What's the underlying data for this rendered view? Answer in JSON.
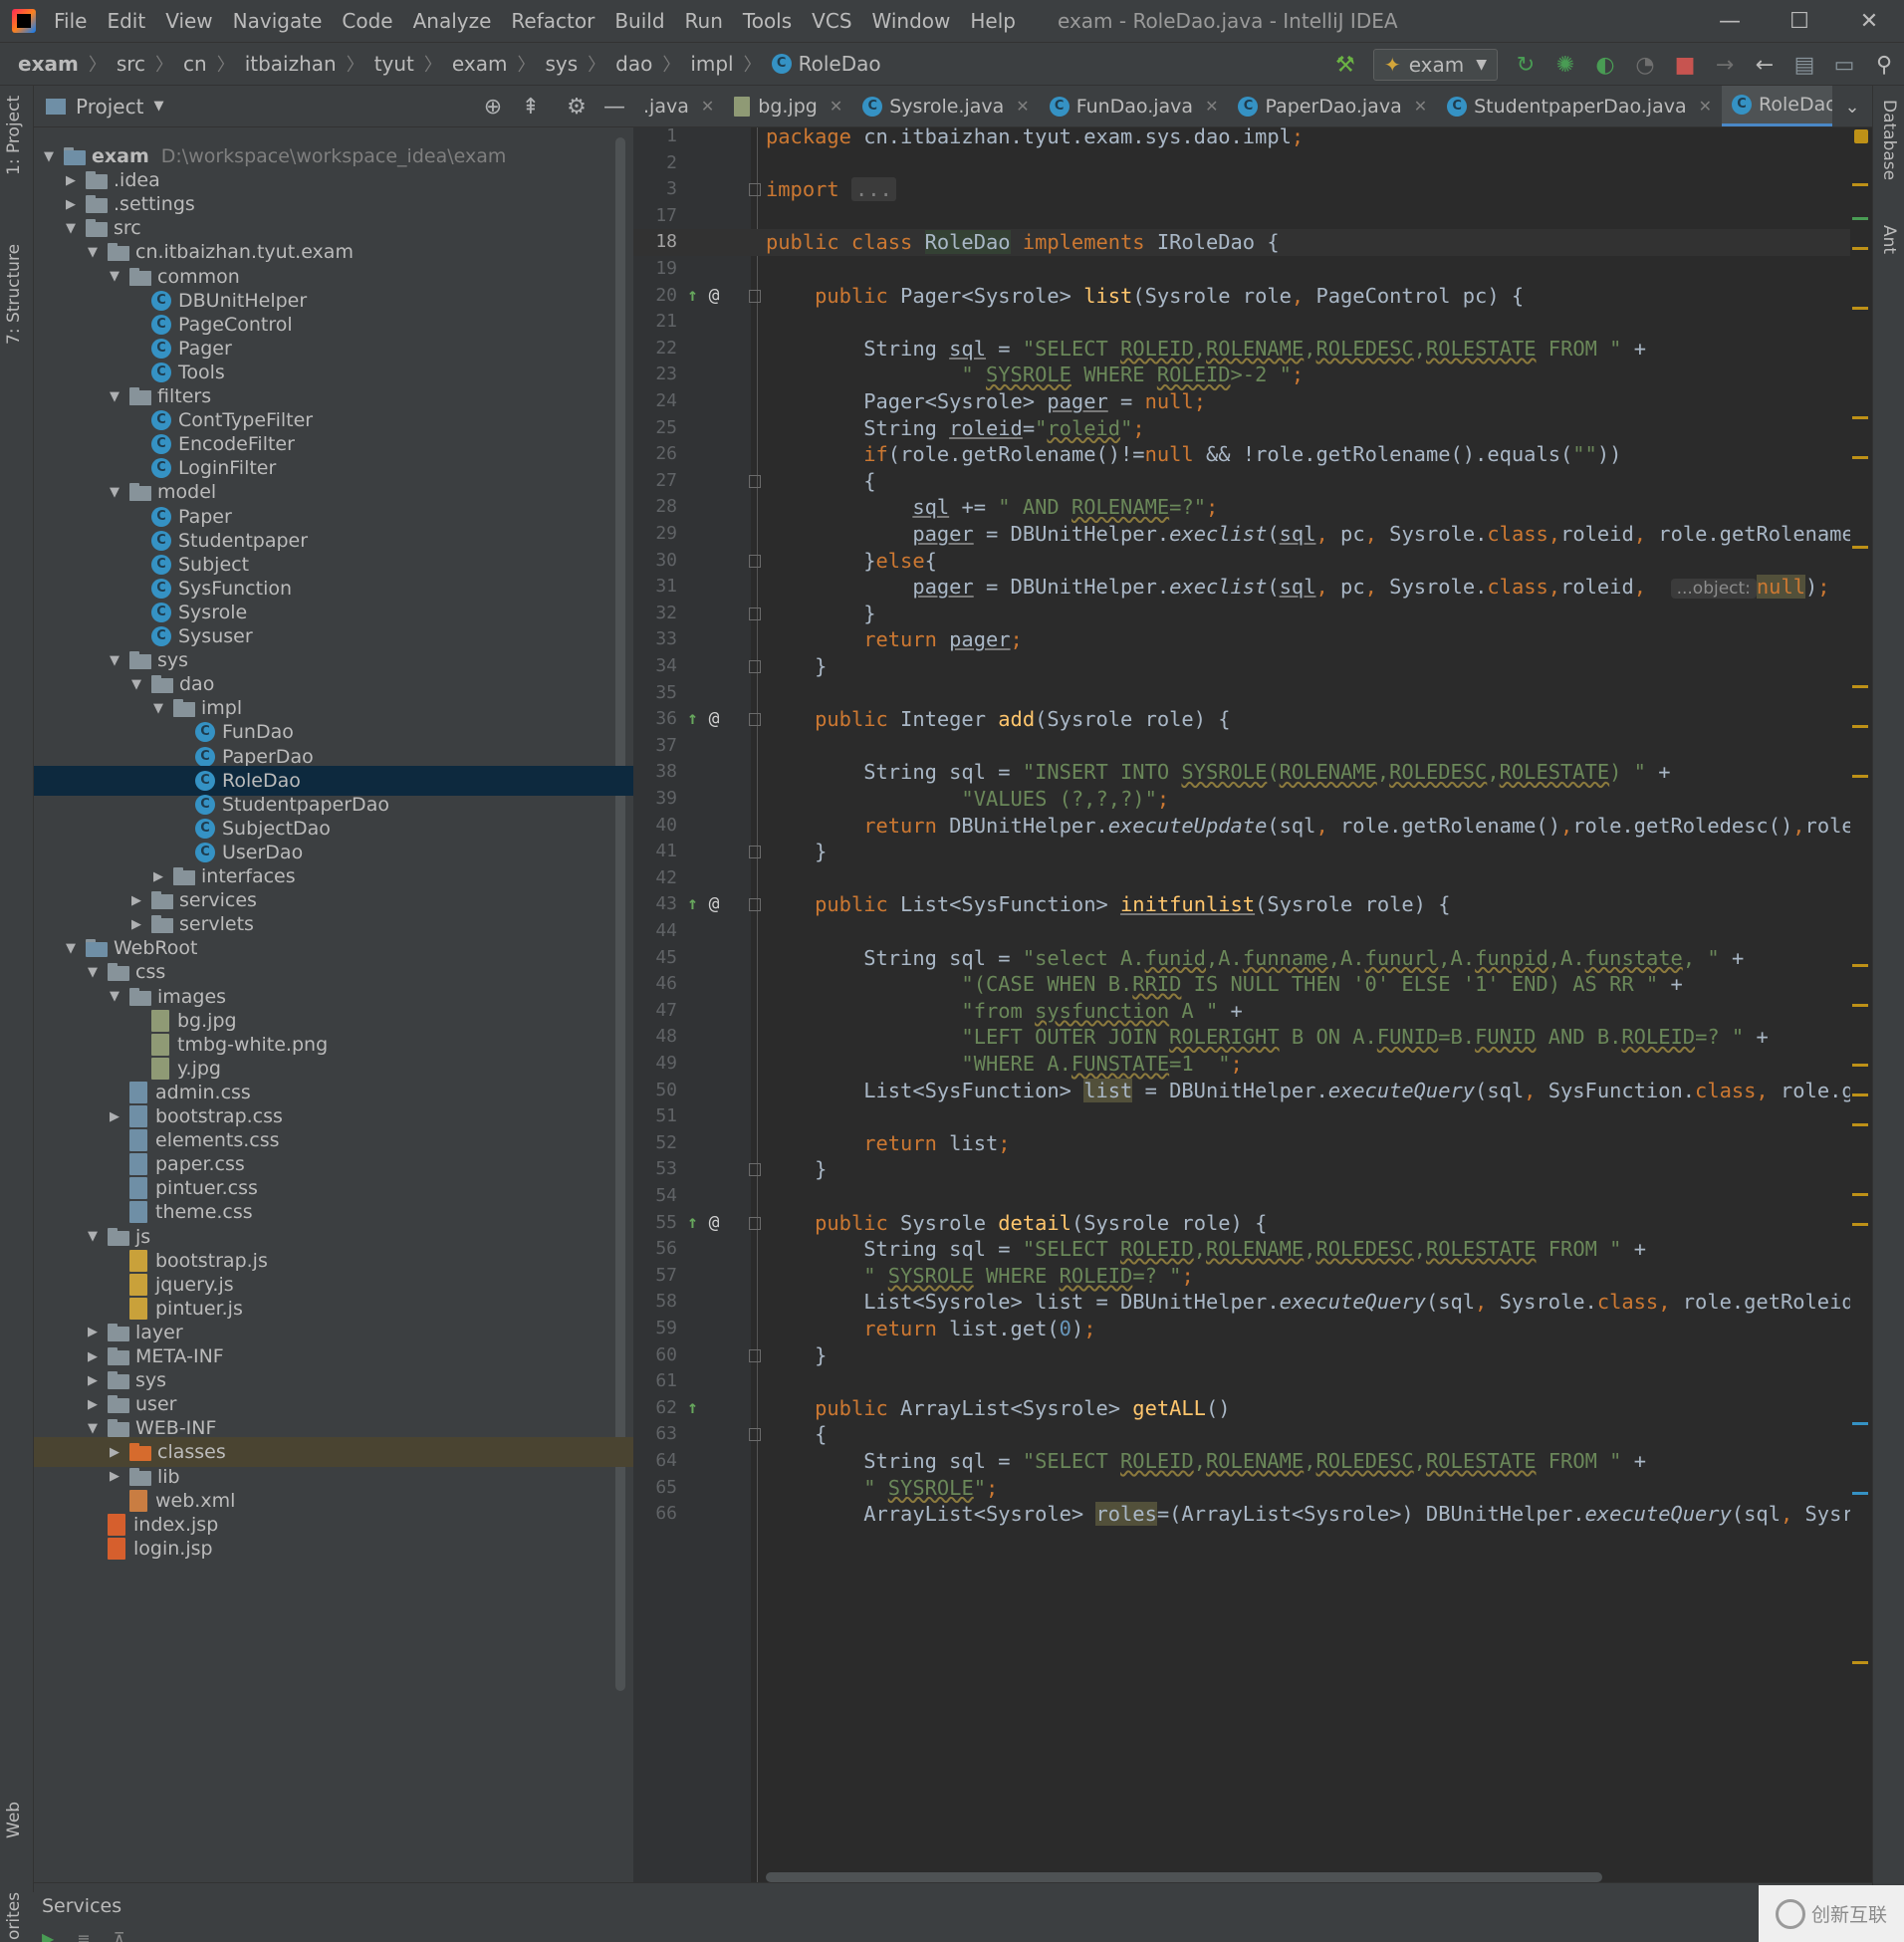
{
  "window": {
    "title": "exam - RoleDao.java - IntelliJ IDEA",
    "menu": [
      "File",
      "Edit",
      "View",
      "Navigate",
      "Code",
      "Analyze",
      "Refactor",
      "Build",
      "Run",
      "Tools",
      "VCS",
      "Window",
      "Help"
    ]
  },
  "breadcrumb": [
    "exam",
    "src",
    "cn",
    "itbaizhan",
    "tyut",
    "exam",
    "sys",
    "dao",
    "impl",
    "RoleDao"
  ],
  "toolbar": {
    "run_config": "exam"
  },
  "side_tabs": {
    "project": "1: Project",
    "structure": "7: Structure",
    "web": "Web",
    "favorites": "orites",
    "database": "Database",
    "ant": "Ant"
  },
  "project_panel": {
    "title": "Project",
    "tree": [
      {
        "depth": 0,
        "type": "module",
        "label": "exam",
        "path": "D:\\workspace\\workspace_idea\\exam",
        "arrow": "down"
      },
      {
        "depth": 1,
        "type": "folder",
        "label": ".idea",
        "arrow": "right"
      },
      {
        "depth": 1,
        "type": "folder",
        "label": ".settings",
        "arrow": "right"
      },
      {
        "depth": 1,
        "type": "folder",
        "label": "src",
        "arrow": "down"
      },
      {
        "depth": 2,
        "type": "package",
        "label": "cn.itbaizhan.tyut.exam",
        "arrow": "down"
      },
      {
        "depth": 3,
        "type": "package",
        "label": "common",
        "arrow": "down"
      },
      {
        "depth": 4,
        "type": "class",
        "label": "DBUnitHelper"
      },
      {
        "depth": 4,
        "type": "class",
        "label": "PageControl"
      },
      {
        "depth": 4,
        "type": "class",
        "label": "Pager"
      },
      {
        "depth": 4,
        "type": "class",
        "label": "Tools"
      },
      {
        "depth": 3,
        "type": "package",
        "label": "filters",
        "arrow": "down"
      },
      {
        "depth": 4,
        "type": "class",
        "label": "ContTypeFilter"
      },
      {
        "depth": 4,
        "type": "class",
        "label": "EncodeFilter"
      },
      {
        "depth": 4,
        "type": "class",
        "label": "LoginFilter"
      },
      {
        "depth": 3,
        "type": "package",
        "label": "model",
        "arrow": "down"
      },
      {
        "depth": 4,
        "type": "class",
        "label": "Paper"
      },
      {
        "depth": 4,
        "type": "class",
        "label": "Studentpaper"
      },
      {
        "depth": 4,
        "type": "class",
        "label": "Subject"
      },
      {
        "depth": 4,
        "type": "class",
        "label": "SysFunction"
      },
      {
        "depth": 4,
        "type": "class",
        "label": "Sysrole"
      },
      {
        "depth": 4,
        "type": "class",
        "label": "Sysuser"
      },
      {
        "depth": 3,
        "type": "package",
        "label": "sys",
        "arrow": "down"
      },
      {
        "depth": 4,
        "type": "package",
        "label": "dao",
        "arrow": "down"
      },
      {
        "depth": 5,
        "type": "package",
        "label": "impl",
        "arrow": "down"
      },
      {
        "depth": 6,
        "type": "class",
        "label": "FunDao"
      },
      {
        "depth": 6,
        "type": "class",
        "label": "PaperDao"
      },
      {
        "depth": 6,
        "type": "class",
        "label": "RoleDao",
        "selected": true
      },
      {
        "depth": 6,
        "type": "class",
        "label": "StudentpaperDao"
      },
      {
        "depth": 6,
        "type": "class",
        "label": "SubjectDao"
      },
      {
        "depth": 6,
        "type": "class",
        "label": "UserDao"
      },
      {
        "depth": 5,
        "type": "package",
        "label": "interfaces",
        "arrow": "right"
      },
      {
        "depth": 4,
        "type": "package",
        "label": "services",
        "arrow": "right"
      },
      {
        "depth": 4,
        "type": "package",
        "label": "servlets",
        "arrow": "right"
      },
      {
        "depth": 1,
        "type": "module",
        "label": "WebRoot",
        "arrow": "down"
      },
      {
        "depth": 2,
        "type": "folder",
        "label": "css",
        "arrow": "down"
      },
      {
        "depth": 3,
        "type": "folder",
        "label": "images",
        "arrow": "down"
      },
      {
        "depth": 4,
        "type": "img",
        "label": "bg.jpg"
      },
      {
        "depth": 4,
        "type": "img",
        "label": "tmbg-white.png"
      },
      {
        "depth": 4,
        "type": "img",
        "label": "y.jpg"
      },
      {
        "depth": 3,
        "type": "css",
        "label": "admin.css"
      },
      {
        "depth": 3,
        "type": "css",
        "label": "bootstrap.css",
        "arrow": "right"
      },
      {
        "depth": 3,
        "type": "css",
        "label": "elements.css"
      },
      {
        "depth": 3,
        "type": "css",
        "label": "paper.css"
      },
      {
        "depth": 3,
        "type": "css",
        "label": "pintuer.css"
      },
      {
        "depth": 3,
        "type": "css",
        "label": "theme.css"
      },
      {
        "depth": 2,
        "type": "folder",
        "label": "js",
        "arrow": "down"
      },
      {
        "depth": 3,
        "type": "js",
        "label": "bootstrap.js"
      },
      {
        "depth": 3,
        "type": "js",
        "label": "jquery.js"
      },
      {
        "depth": 3,
        "type": "js",
        "label": "pintuer.js"
      },
      {
        "depth": 2,
        "type": "folder",
        "label": "layer",
        "arrow": "right"
      },
      {
        "depth": 2,
        "type": "folder",
        "label": "META-INF",
        "arrow": "right"
      },
      {
        "depth": 2,
        "type": "folder",
        "label": "sys",
        "arrow": "right"
      },
      {
        "depth": 2,
        "type": "folder",
        "label": "user",
        "arrow": "right"
      },
      {
        "depth": 2,
        "type": "folder",
        "label": "WEB-INF",
        "arrow": "down"
      },
      {
        "depth": 3,
        "type": "orange",
        "label": "classes",
        "arrow": "right",
        "highlight": true
      },
      {
        "depth": 3,
        "type": "folder",
        "label": "lib",
        "arrow": "right"
      },
      {
        "depth": 3,
        "type": "xml",
        "label": "web.xml"
      },
      {
        "depth": 2,
        "type": "jsp",
        "label": "index.jsp"
      },
      {
        "depth": 2,
        "type": "jsp",
        "label": "login.jsp"
      }
    ]
  },
  "editor_tabs": [
    {
      "label": ".java",
      "icon": "none"
    },
    {
      "label": "bg.jpg",
      "icon": "image"
    },
    {
      "label": "Sysrole.java",
      "icon": "class"
    },
    {
      "label": "FunDao.java",
      "icon": "class"
    },
    {
      "label": "PaperDao.java",
      "icon": "class"
    },
    {
      "label": "StudentpaperDao.java",
      "icon": "class"
    },
    {
      "label": "RoleDao.java",
      "icon": "class",
      "active": true
    }
  ],
  "editor": {
    "current_line": "18",
    "lines": [
      {
        "n": "1",
        "html": "<span class=\"kw\">package </span>cn.itbaizhan.tyut.exam.sys.dao.impl<span class=\"kw\">;</span>"
      },
      {
        "n": "2",
        "html": ""
      },
      {
        "n": "3",
        "html": "<span class=\"kw\">import </span><span class=\"fold-box\">...</span>",
        "fold": true
      },
      {
        "n": "17",
        "html": ""
      },
      {
        "n": "18",
        "html": "<span class=\"kw\">public class </span><span class=\"ref\">RoleDao</span> <span class=\"kw\">implements </span>IRoleDao {"
      },
      {
        "n": "19",
        "html": ""
      },
      {
        "n": "20",
        "html": "    <span class=\"kw\">public </span>Pager&lt;Sysrole&gt; <span class=\"fn\">list</span>(Sysrole role<span class=\"kw\">, </span>PageControl pc) {",
        "impl": true,
        "fold": true
      },
      {
        "n": "21",
        "html": ""
      },
      {
        "n": "22",
        "html": "        String <span class=\"ul\">sql</span> = <span class=\"str\">\"SELECT <span class=\"sq\">ROLEID</span>,<span class=\"sq\">ROLENAME</span>,<span class=\"sq\">ROLEDESC</span>,<span class=\"sq\">ROLESTATE</span> FROM \"</span> +"
      },
      {
        "n": "23",
        "html": "                <span class=\"str\">\" <span class=\"sq\">SYSROLE</span> WHERE <span class=\"sq\">ROLEID</span>&gt;-2 \"</span><span class=\"kw\">;</span>"
      },
      {
        "n": "24",
        "html": "        Pager&lt;Sysrole&gt; <span class=\"ul\">pager</span> = <span class=\"kw\">null;</span>"
      },
      {
        "n": "25",
        "html": "        String <span class=\"ul\">roleid</span>=<span class=\"str\">\"<span class=\"sq\">roleid</span>\"</span><span class=\"kw\">;</span>"
      },
      {
        "n": "26",
        "html": "        <span class=\"kw\">if</span>(role.getRolename()!=<span class=\"kw\">null </span>&amp;&amp; !role.getRolename().equals(<span class=\"str\">\"\"</span>))"
      },
      {
        "n": "27",
        "html": "        {",
        "fold": true
      },
      {
        "n": "28",
        "html": "            <span class=\"ul\">sql</span> += <span class=\"str\">\" AND <span class=\"sq\">ROLENAME</span>=?\"</span><span class=\"kw\">;</span>"
      },
      {
        "n": "29",
        "html": "            <span class=\"ul\">pager</span> = DBUnitHelper.<span class=\"it\">execlist</span>(<span class=\"ul\">sql</span><span class=\"kw\">, </span>pc<span class=\"kw\">, </span>Sysrole.<span class=\"kw\">class,</span>roleid<span class=\"kw\">, </span>role.getRolename())<span class=\"kw\">;</span>"
      },
      {
        "n": "30",
        "html": "        }<span class=\"kw\">else</span>{",
        "fold": true
      },
      {
        "n": "31",
        "html": "            <span class=\"ul\">pager</span> = DBUnitHelper.<span class=\"it\">execlist</span>(<span class=\"ul\">sql</span><span class=\"kw\">, </span>pc<span class=\"kw\">, </span>Sysrole.<span class=\"kw\">class,</span>roleid<span class=\"kw\">, </span> <span class=\"hint\">...object:</span><span class=\"hl kw\">null</span>)<span class=\"kw\">;</span>"
      },
      {
        "n": "32",
        "html": "        }",
        "fold": true
      },
      {
        "n": "33",
        "html": "        <span class=\"kw\">return </span><span class=\"ul\">pager</span><span class=\"kw\">;</span>"
      },
      {
        "n": "34",
        "html": "    }",
        "fold": true
      },
      {
        "n": "35",
        "html": ""
      },
      {
        "n": "36",
        "html": "    <span class=\"kw\">public </span>Integer <span class=\"fn\">add</span>(Sysrole role) {",
        "impl": true,
        "fold": true
      },
      {
        "n": "37",
        "html": ""
      },
      {
        "n": "38",
        "html": "        String sql = <span class=\"str\">\"INSERT INTO <span class=\"sq\">SYSROLE</span>(<span class=\"sq\">ROLENAME</span>,<span class=\"sq\">ROLEDESC</span>,<span class=\"sq\">ROLESTATE</span>) \"</span> +"
      },
      {
        "n": "39",
        "html": "                <span class=\"str\">\"VALUES (?,?,?)\"</span><span class=\"kw\">;</span>"
      },
      {
        "n": "40",
        "html": "        <span class=\"kw\">return </span>DBUnitHelper.<span class=\"it\">executeUpdate</span>(sql<span class=\"kw\">, </span>role.getRolename()<span class=\"kw\">,</span>role.getRoledesc()<span class=\"kw\">,</span>role.getRolestate())<span class=\"kw\">;</span>"
      },
      {
        "n": "41",
        "html": "    }",
        "fold": true
      },
      {
        "n": "42",
        "html": ""
      },
      {
        "n": "43",
        "html": "    <span class=\"kw\">public </span>List&lt;SysFunction&gt; <span class=\"fn ul\">initfunlist</span>(Sysrole role) {",
        "impl": true,
        "fold": true
      },
      {
        "n": "44",
        "html": ""
      },
      {
        "n": "45",
        "html": "        String sql = <span class=\"str\">\"select A.<span class=\"sq\">funid</span>,A.<span class=\"sq\">funname</span>,A.<span class=\"sq\">funurl</span>,A.<span class=\"sq\">funpid</span>,A.<span class=\"sq\">funstate</span>, \"</span> +"
      },
      {
        "n": "46",
        "html": "                <span class=\"str\">\"(CASE WHEN B.<span class=\"sq\">RRID</span> IS NULL THEN '0' ELSE '1' END) AS RR \"</span> +"
      },
      {
        "n": "47",
        "html": "                <span class=\"str\">\"from <span class=\"sq\">sysfunction</span> A \"</span> +"
      },
      {
        "n": "48",
        "html": "                <span class=\"str\">\"LEFT OUTER JOIN <span class=\"sq\">ROLERIGHT</span> B ON A.<span class=\"sq\">FUNID</span>=B.<span class=\"sq\">FUNID</span> AND B.<span class=\"sq\">ROLEID</span>=? \"</span> +"
      },
      {
        "n": "49",
        "html": "                <span class=\"str\">\"WHERE A.<span class=\"sq\">FUNSTATE</span>=1  \"</span><span class=\"kw\">;</span>"
      },
      {
        "n": "50",
        "html": "        List&lt;SysFunction&gt; <span class=\"hl\">list</span> = DBUnitHelper.<span class=\"it\">executeQuery</span>(sql<span class=\"kw\">, </span>SysFunction.<span class=\"kw\">class, </span>role.getRoleid())<span class=\"kw\">;</span>"
      },
      {
        "n": "51",
        "html": ""
      },
      {
        "n": "52",
        "html": "        <span class=\"kw\">return </span>list<span class=\"kw\">;</span>"
      },
      {
        "n": "53",
        "html": "    }",
        "fold": true
      },
      {
        "n": "54",
        "html": ""
      },
      {
        "n": "55",
        "html": "    <span class=\"kw\">public </span>Sysrole <span class=\"fn\">detail</span>(Sysrole role) {",
        "impl": true,
        "fold": true
      },
      {
        "n": "56",
        "html": "        String sql = <span class=\"str\">\"SELECT <span class=\"sq\">ROLEID</span>,<span class=\"sq\">ROLENAME</span>,<span class=\"sq\">ROLEDESC</span>,<span class=\"sq\">ROLESTATE</span> FROM \"</span> +"
      },
      {
        "n": "57",
        "html": "        <span class=\"str\">\" <span class=\"sq\">SYSROLE</span> WHERE <span class=\"sq\">ROLEID</span>=? \"</span><span class=\"kw\">;</span>"
      },
      {
        "n": "58",
        "html": "        List&lt;Sysrole&gt; list = DBUnitHelper.<span class=\"it\">executeQuery</span>(sql<span class=\"kw\">, </span>Sysrole.<span class=\"kw\">class, </span>role.getRoleid())<span class=\"kw\">;</span>"
      },
      {
        "n": "59",
        "html": "        <span class=\"kw\">return </span>list.get(<span class=\"num\">0</span>)<span class=\"kw\">;</span>"
      },
      {
        "n": "60",
        "html": "    }",
        "fold": true
      },
      {
        "n": "61",
        "html": ""
      },
      {
        "n": "62",
        "html": "    <span class=\"kw\">public </span>ArrayList&lt;Sysrole&gt; <span class=\"fn\">getALL</span>()",
        "impl_only": true
      },
      {
        "n": "63",
        "html": "    {",
        "fold": true
      },
      {
        "n": "64",
        "html": "        String sql = <span class=\"str\">\"SELECT <span class=\"sq\">ROLEID</span>,<span class=\"sq\">ROLENAME</span>,<span class=\"sq\">ROLEDESC</span>,<span class=\"sq\">ROLESTATE</span> FROM \"</span> +"
      },
      {
        "n": "65",
        "html": "        <span class=\"str\">\" <span class=\"sq\">SYSROLE</span>\"</span><span class=\"kw\">;</span>"
      },
      {
        "n": "66",
        "html": "        ArrayList&lt;Sysrole&gt; <span class=\"hl\">roles</span>=(ArrayList&lt;Sysrole&gt;) DBUnitHelper.<span class=\"it\">executeQuery</span>(sql<span class=\"kw\">, </span>Sysrole.<span class=\"kw\">class</span>)<span class=\"kw\">;</span>"
      }
    ]
  },
  "services": {
    "label": "Services"
  },
  "watermark": "创新互联",
  "colors": {
    "accent": "#4a88c7",
    "keyword": "#cc7832",
    "string": "#6a8759",
    "function": "#ffc66d",
    "background": "#2b2b2b"
  }
}
